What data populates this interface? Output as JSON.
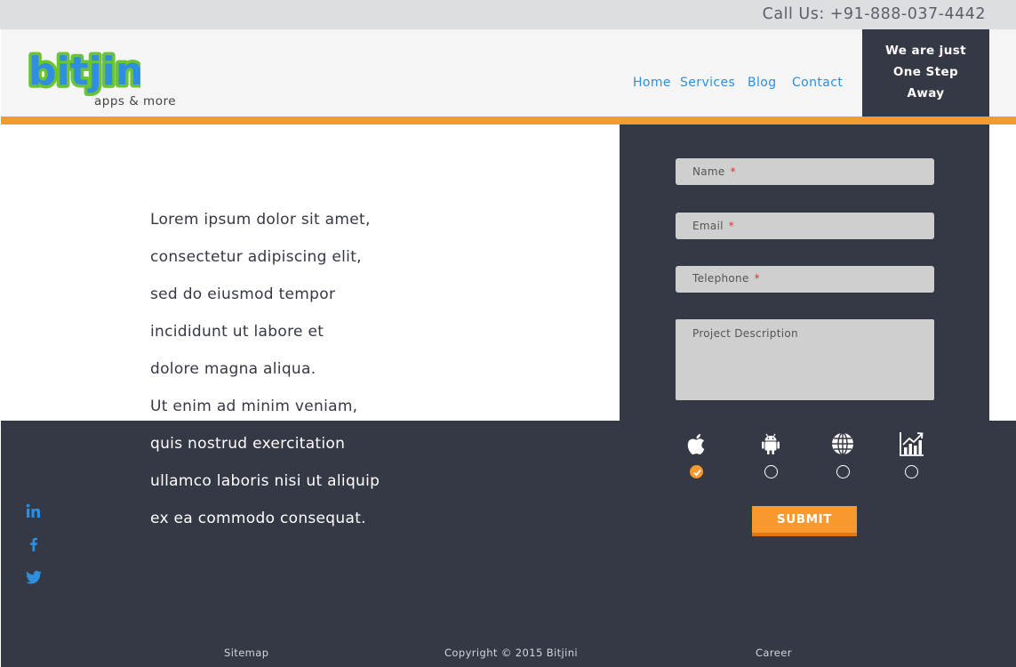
{
  "topbar": {
    "call_text": "Call Us: +91-888-037-4442"
  },
  "logo": {
    "text": "bitjini",
    "tagline": "apps & more"
  },
  "nav": [
    {
      "label": "Home"
    },
    {
      "label": "Services"
    },
    {
      "label": "Blog"
    },
    {
      "label": "Contact"
    }
  ],
  "promo": {
    "lines": [
      "We are just",
      "One Step",
      "Away"
    ]
  },
  "intro": {
    "lines": [
      "Lorem ipsum dolor sit amet,",
      "consectetur adipiscing elit,",
      "sed do eiusmod tempor",
      "incididunt ut labore et",
      "dolore magna aliqua.",
      "Ut enim ad minim veniam,",
      "quis nostrud exercitation",
      "ullamco laboris nisi ut aliquip",
      "ex ea commodo consequat."
    ]
  },
  "form": {
    "name_placeholder": "Name",
    "email_placeholder": "Email",
    "telephone_placeholder": "Telephone",
    "description_placeholder": "Project Description",
    "required_mark": "*",
    "submit_label": "SUBMIT"
  },
  "platforms": [
    {
      "icon": "apple-icon",
      "selected": true
    },
    {
      "icon": "android-icon",
      "selected": false
    },
    {
      "icon": "globe-icon",
      "selected": false
    },
    {
      "icon": "chart-icon",
      "selected": false
    }
  ],
  "social": [
    "linkedin-icon",
    "facebook-icon",
    "twitter-icon"
  ],
  "footer": {
    "sitemap": "Sitemap",
    "copyright": "Copyright © 2015 Bitjini",
    "career": "Career"
  },
  "colors": {
    "accent": "#f7992f",
    "dark": "#353845",
    "link": "#2d8fe0",
    "logo_green": "#6cc334",
    "logo_blue": "#2f8ee0"
  }
}
